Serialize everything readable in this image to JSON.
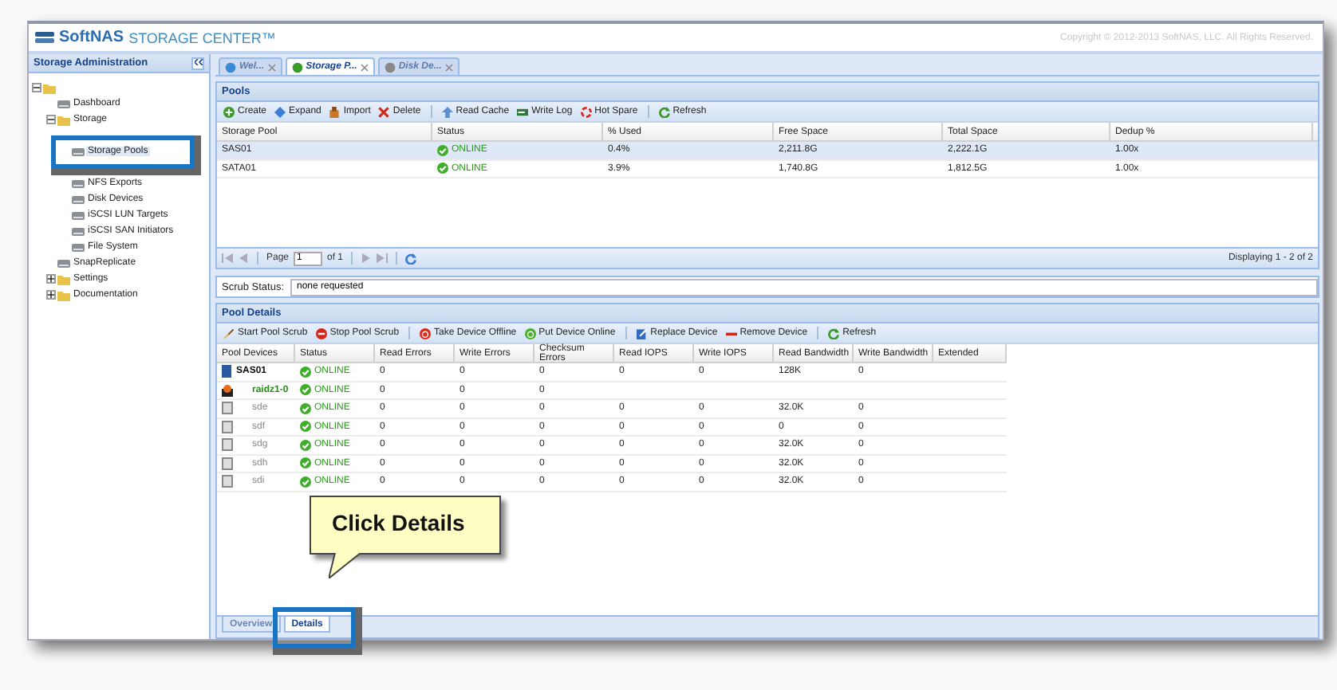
{
  "app": {
    "brand": "SoftNAS",
    "title": "STORAGE CENTER™",
    "copyright": "Copyright © 2012-2013 SoftNAS, LLC. All Rights Reserved."
  },
  "sidebar": {
    "title": "Storage Administration",
    "tree": [
      {
        "expanded": true,
        "children": [
          {
            "label": "Dashboard"
          },
          {
            "label": "Storage",
            "expanded": true,
            "children": [
              {
                "label": "Storage Pools",
                "selected": true
              },
              {
                "label": "NFS Exports",
                "selected": false
              },
              {
                "label": "Disk Devices",
                "selected": false
              },
              {
                "label": "iSCSI LUN Targets",
                "selected": false
              },
              {
                "label": "iSCSI SAN Initiators",
                "selected": false
              },
              {
                "label": "File System",
                "selected": false
              }
            ]
          },
          {
            "label": "SnapReplicate"
          },
          {
            "label": "Settings",
            "expanded": false
          },
          {
            "label": "Documentation",
            "expanded": false
          }
        ]
      }
    ]
  },
  "tabs": [
    {
      "label": "Wel...",
      "selected": false
    },
    {
      "label": "Storage P...",
      "selected": true
    },
    {
      "label": "Disk De...",
      "selected": false
    }
  ],
  "pools": {
    "title": "Pools",
    "toolbar": [
      [
        "Create",
        "Expand",
        "Import",
        "Delete"
      ],
      [
        "Read Cache",
        "Write Log",
        "Hot Spare"
      ],
      [
        "Refresh"
      ]
    ],
    "columns": [
      "Storage Pool",
      "Status",
      "% Used",
      "Free Space",
      "Total Space",
      "Dedup %"
    ],
    "rows": [
      {
        "selected": true,
        "cells": [
          "SAS01",
          "ONLINE",
          "0.4%",
          "2,211.8G",
          "2,222.1G",
          "1.00x"
        ]
      },
      {
        "selected": false,
        "cells": [
          "SATA01",
          "ONLINE",
          "3.9%",
          "1,740.8G",
          "1,812.5G",
          "1.00x"
        ]
      }
    ],
    "pager": {
      "page_label": "Page",
      "page": "1",
      "of": "of 1",
      "summary": "Displaying 1 - 2 of 2"
    }
  },
  "scrub": {
    "label": "Scrub Status:",
    "value": "none requested"
  },
  "pool_details": {
    "title": "Pool Details",
    "toolbar": [
      [
        "Start Pool Scrub",
        "Stop Pool Scrub"
      ],
      [
        "Take Device Offline",
        "Put Device Online"
      ],
      [
        "Replace Device",
        "Remove Device"
      ],
      [
        "Refresh"
      ]
    ],
    "columns": [
      "Pool Devices",
      "Status",
      "Read Errors",
      "Write Errors",
      "Checksum Errors",
      "Read IOPS",
      "Write IOPS",
      "Read Bandwidth",
      "Write Bandwidth",
      "Extended"
    ],
    "rows": [
      {
        "kind": "pool",
        "cells": [
          "SAS01",
          "ONLINE",
          "0",
          "0",
          "0",
          "0",
          "0",
          "128K",
          "0"
        ]
      },
      {
        "kind": "vdev",
        "cells": [
          "raidz1-0",
          "ONLINE",
          "0",
          "0",
          "0"
        ]
      },
      {
        "kind": "disk",
        "cells": [
          "sde",
          "ONLINE",
          "0",
          "0",
          "0",
          "0",
          "0",
          "32.0K",
          "0"
        ]
      },
      {
        "kind": "disk",
        "cells": [
          "sdf",
          "ONLINE",
          "0",
          "0",
          "0",
          "0",
          "0",
          "0",
          "0"
        ]
      },
      {
        "kind": "disk",
        "cells": [
          "sdg",
          "ONLINE",
          "0",
          "0",
          "0",
          "0",
          "0",
          "32.0K",
          "0"
        ]
      },
      {
        "kind": "disk",
        "cells": [
          "sdh",
          "ONLINE",
          "0",
          "0",
          "0",
          "0",
          "0",
          "32.0K",
          "0"
        ]
      },
      {
        "kind": "disk",
        "cells": [
          "sdi",
          "ONLINE",
          "0",
          "0",
          "0",
          "0",
          "0",
          "32.0K",
          "0"
        ]
      }
    ]
  },
  "bottom_tabs": [
    {
      "label": "Overview",
      "selected": false
    },
    {
      "label": "Details",
      "selected": true
    }
  ],
  "callout": {
    "text": "Click Details"
  }
}
